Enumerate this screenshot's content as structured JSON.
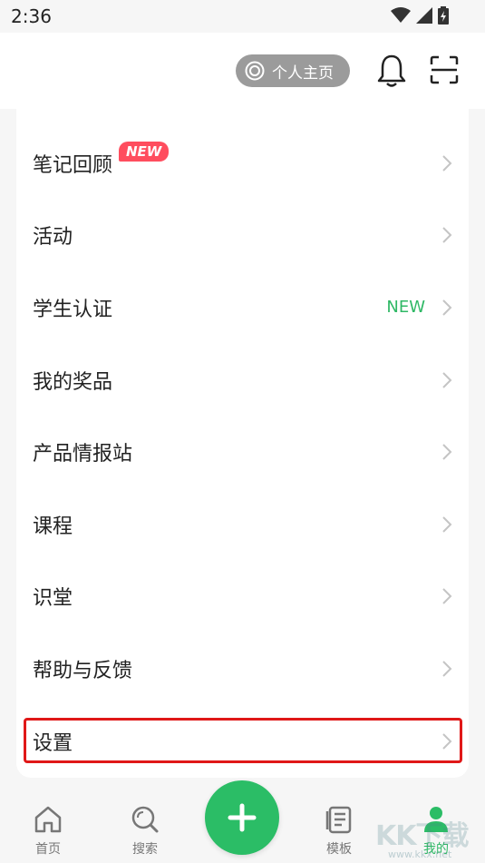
{
  "status": {
    "time": "2:36"
  },
  "header": {
    "profile_button": "个人主页"
  },
  "menu": {
    "items": [
      {
        "label": "笔记回顾",
        "badge": "NEW"
      },
      {
        "label": "活动"
      },
      {
        "label": "学生认证",
        "tag": "NEW"
      },
      {
        "label": "我的奖品"
      },
      {
        "label": "产品情报站"
      },
      {
        "label": "课程"
      },
      {
        "label": "识堂"
      },
      {
        "label": "帮助与反馈"
      },
      {
        "label": "设置"
      }
    ]
  },
  "tabbar": {
    "home": "首页",
    "search": "搜索",
    "templates": "模板",
    "mine": "我的"
  },
  "watermark": {
    "text": "KK下载",
    "url": "www.kkx.net"
  },
  "colors": {
    "accent": "#2bbd66",
    "badge": "#ff4d5e",
    "highlight": "#e01818"
  }
}
